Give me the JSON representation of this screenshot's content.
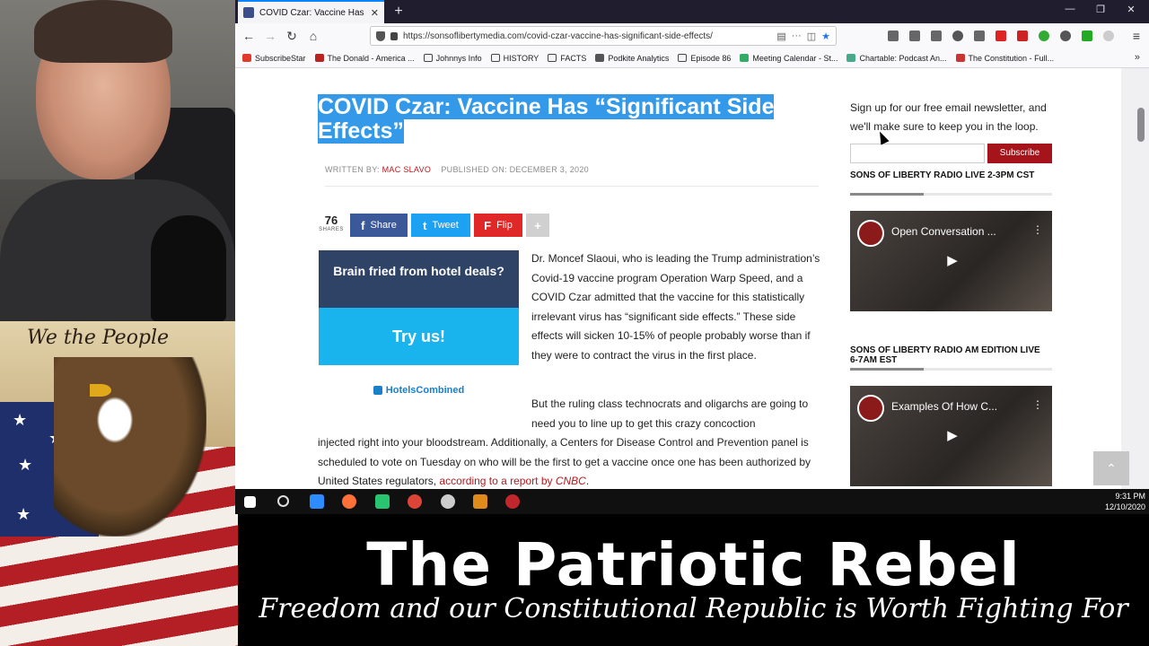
{
  "browser": {
    "tab_title": "COVID Czar: Vaccine Has “Sign",
    "tab_close": "✕",
    "new_tab": "+",
    "url": "https://sonsoflibertymedia.com/covid-czar-vaccine-has-significant-side-effects/",
    "more": "···",
    "window_controls": [
      "—",
      "❐",
      "✕"
    ]
  },
  "bookmarks": [
    {
      "label": "SubscribeStar",
      "color": "#e33b2b"
    },
    {
      "label": "The Donald - America ...",
      "color": "#b22"
    },
    {
      "label": "Johnnys Info",
      "color": "folder"
    },
    {
      "label": "HISTORY",
      "color": "folder"
    },
    {
      "label": "FACTS",
      "color": "folder"
    },
    {
      "label": "Podkite Analytics",
      "color": "#555"
    },
    {
      "label": "Episode 86",
      "color": "folder"
    },
    {
      "label": "Meeting Calendar - St...",
      "color": "#3a6"
    },
    {
      "label": "Chartable: Podcast An...",
      "color": "#4a8"
    },
    {
      "label": "The Constitution - Full...",
      "color": "#c33"
    }
  ],
  "article": {
    "title": "COVID Czar: Vaccine Has “Significant Side Effects”",
    "written_by_label": "WRITTEN BY:",
    "author": "MAC SLAVO",
    "published_label": "PUBLISHED ON: DECEMBER 3, 2020",
    "share_count": "76",
    "shares_label": "SHARES",
    "share_buttons": [
      {
        "label": "Share",
        "icon": "f",
        "color": "#3b5998"
      },
      {
        "label": "Tweet",
        "icon": "t",
        "color": "#1da1f2"
      },
      {
        "label": "Flip",
        "icon": "F",
        "color": "#e12828"
      },
      {
        "label": "",
        "icon": "+",
        "color": "#d0d0d0"
      }
    ],
    "para1": "Dr. Moncef Slaoui, who is leading the Trump administration’s Covid-19 vaccine program Operation Warp Speed, and a COVID Czar admitted that the vaccine for this statistically irrelevant virus has “significant side effects.” These side effects will sicken 10-15% of people probably worse than if they were to contract the virus in the first place.",
    "para2_top": "But the ruling class technocrats and oligarchs are going to need you to line up to get this crazy concoction",
    "para2_rest": "injected right into your bloodstream. Additionally, a Centers for  Disease Control and Prevention panel is scheduled to vote on Tuesday on who will be the first to get a vaccine once one has been authorized by United States regulators,",
    "link_text": "according to a report by",
    "link_source": "CNBC",
    "link_end": "."
  },
  "ad": {
    "headline": "Brain fried from hotel deals?",
    "cta": "Try us!",
    "brand": "HotelsCombined"
  },
  "sidebar": {
    "newsletter": "Sign up for our free email newsletter, and we'll make sure to keep you in the loop.",
    "subscribe_label": "Subscribe",
    "section1": "SONS OF LIBERTY RADIO LIVE 2-3PM CST",
    "video1": "Open Conversation ...",
    "section2": "SONS OF LIBERTY RADIO AM EDITION LIVE 6-7AM EST",
    "video2": "Examples Of How C..."
  },
  "taskbar": {
    "time": "9:31 PM",
    "date": "12/10/2020"
  },
  "banner": {
    "title": "The Patriotic Rebel",
    "subtitle": "Freedom and our Constitutional Republic is Worth Fighting For"
  },
  "artwork": {
    "script_text": "We the People"
  }
}
